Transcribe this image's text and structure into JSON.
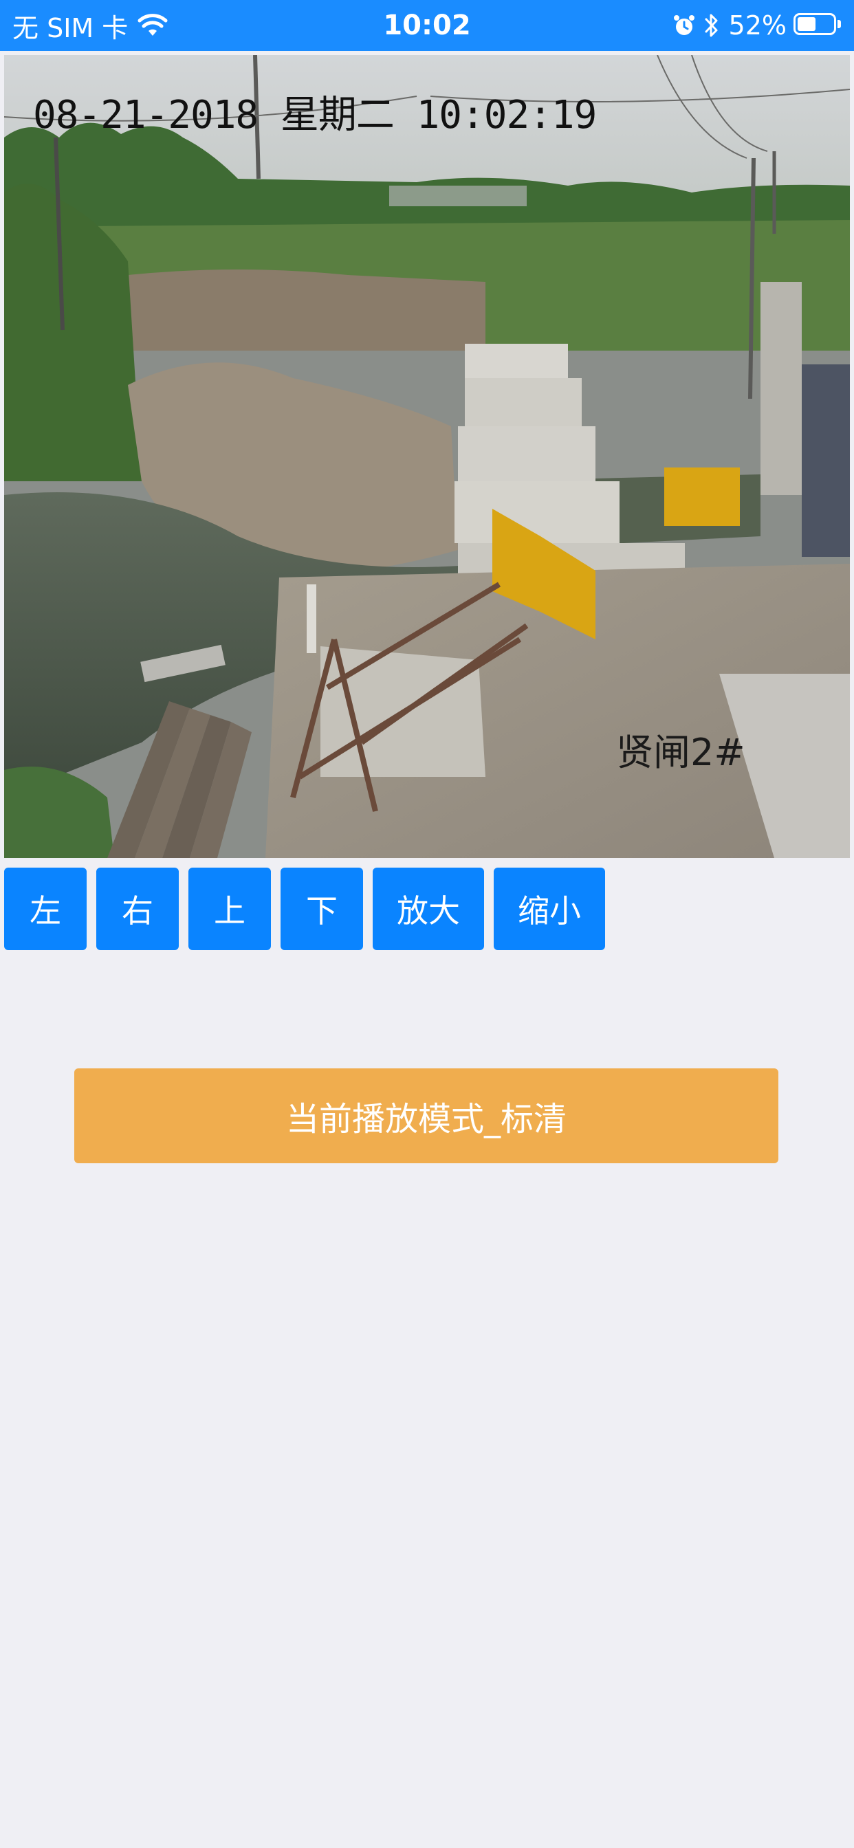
{
  "status_bar": {
    "carrier": "无 SIM 卡",
    "time": "10:02",
    "battery_percent": "52%",
    "battery_level": 0.52,
    "icons": [
      "wifi-icon",
      "alarm-icon",
      "bluetooth-icon",
      "battery-icon"
    ],
    "background_color": "#1a8cff"
  },
  "camera": {
    "osd_timestamp": "08-21-2018 星期二 10:02:19",
    "location_label": "贤闸2#"
  },
  "controls": {
    "left_label": "左",
    "right_label": "右",
    "up_label": "上",
    "down_label": "下",
    "zoom_in_label": "放大",
    "zoom_out_label": "缩小",
    "button_color": "#0a84ff"
  },
  "mode_bar": {
    "label": "当前播放模式_标清",
    "color": "#f0ad4e"
  }
}
